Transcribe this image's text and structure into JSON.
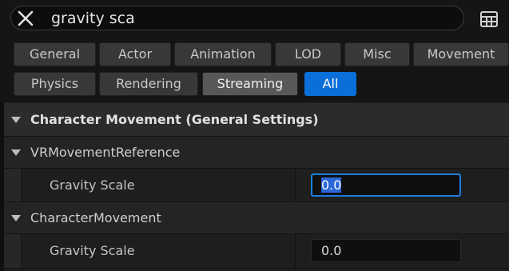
{
  "search": {
    "value": "gravity sca"
  },
  "filters": {
    "row1": [
      "General",
      "Actor",
      "Animation",
      "LOD",
      "Misc",
      "Movement"
    ],
    "row2": [
      "Physics",
      "Rendering",
      "Streaming",
      "All"
    ]
  },
  "categories": [
    {
      "title": "Character Movement (General Settings)",
      "groups": [
        {
          "name": "VRMovementReference",
          "property": {
            "label": "Gravity Scale",
            "value": "0.0"
          }
        },
        {
          "name": "CharacterMovement",
          "property": {
            "label": "Gravity Scale",
            "value": "0.0"
          }
        }
      ]
    }
  ],
  "colors": {
    "accent": "#0a6fd8",
    "focus_border": "#1a7fe0"
  }
}
